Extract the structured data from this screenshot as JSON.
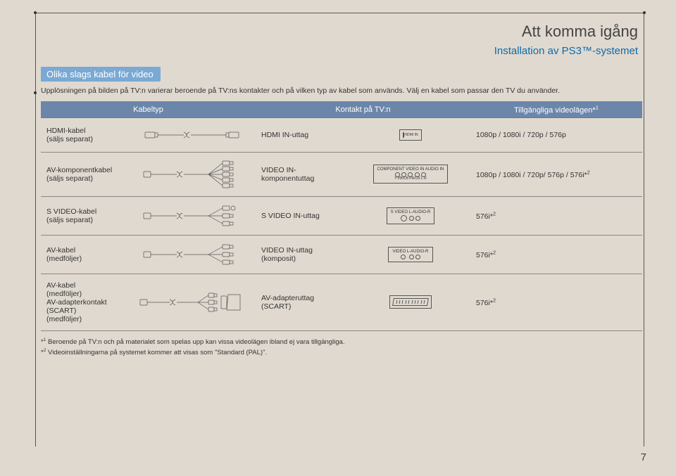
{
  "header": {
    "title": "Att komma igång",
    "subtitle": "Installation av PS3™-systemet"
  },
  "section_head": "Olika slags kabel för video",
  "intro": "Upplösningen på bilden på TV:n varierar beroende på TV:ns kontakter och på vilken typ av kabel som används. Välj en kabel som passar den TV du använder.",
  "table": {
    "headers": {
      "type": "Kabeltyp",
      "connector": "Kontakt på TV:n",
      "modes": "Tillgängliga videolägen*1"
    },
    "rows": [
      {
        "type_name": "HDMI-kabel",
        "type_note": "(säljs separat)",
        "connector": "HDMI IN-uttag",
        "modes": "1080p / 1080i / 720p / 576p",
        "port_icon": "hdmi"
      },
      {
        "type_name": "AV-komponentkabel",
        "type_note": "(säljs separat)",
        "connector": "VIDEO IN-komponentuttag",
        "modes": "1080p / 1080i / 720p/ 576p / 576i*2",
        "port_icon": "component",
        "port_labels": {
          "top": "COMPONENT VIDEO IN    AUDIO IN",
          "bottom": "Y  PB/CB  PR/CR   L   R"
        }
      },
      {
        "type_name": "S VIDEO-kabel",
        "type_note": "(säljs separat)",
        "connector": "S VIDEO IN-uttag",
        "modes": "576i*2",
        "port_icon": "svideo",
        "port_labels": {
          "top": "S VIDEO    L-AUDIO-R"
        }
      },
      {
        "type_name": "AV-kabel",
        "type_note": "(medföljer)",
        "connector": "VIDEO IN-uttag (komposit)",
        "modes": "576i*2",
        "port_icon": "composite",
        "port_labels": {
          "top": "VIDEO    L-AUDIO-R"
        }
      },
      {
        "type_name": "AV-kabel",
        "type_note": "(medföljer)",
        "type_name2": "AV-adapterkontakt (SCART)",
        "type_note2": "(medföljer)",
        "connector": "AV-adapteruttag (SCART)",
        "modes": "576i*2",
        "port_icon": "scart"
      }
    ]
  },
  "footnotes": {
    "f1": "*1 Beroende på TV:n och på materialet som spelas upp kan vissa videolägen ibland ej vara tillgängliga.",
    "f2": "*2 Videoinställningarna på systemet kommer att visas som \"Standard (PAL)\"."
  },
  "page_number": "7"
}
